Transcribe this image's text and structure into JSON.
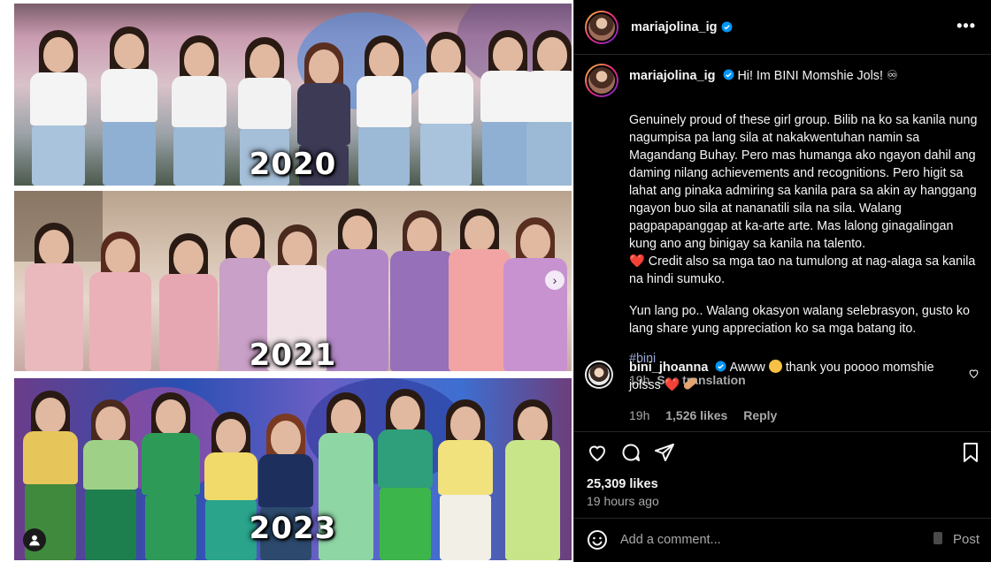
{
  "collage": {
    "panels": [
      {
        "year": "2020"
      },
      {
        "year": "2021"
      },
      {
        "year": "2023"
      }
    ],
    "next_icon": "chevron-right-icon",
    "user_tag_icon": "user-icon"
  },
  "post": {
    "username": "mariajolina_ig",
    "more_icon": "•••",
    "caption": {
      "greeting": "Hi! Im BINI Momshie Jols! ♾",
      "paragraph1": "Genuinely proud of these girl group. Bilib na ko sa kanila nung nagumpisa pa lang sila at nakakwentuhan namin sa Magandang Buhay. Pero mas humanga ako ngayon dahil ang daming nilang achievements and recognitions. Pero higit sa lahat ang pinaka admiring sa kanila para sa akin ay hanggang ngayon buo sila at nananatili sila na sila. Walang pagpapapanggap at ka-arte arte. Mas lalong ginagalingan kung ano ang binigay sa kanila na talento.",
      "heart": "❤️",
      "credit": " Credit also sa mga tao na tumulong at nag-alaga sa kanila na hindi sumuko.",
      "paragraph2": "Yun lang po.. Walang okasyon walang selebrasyon, gusto ko lang share yung appreciation ko sa mga batang ito.",
      "hashtag": "#bini",
      "time": "19h",
      "see_translation": "See translation"
    },
    "comment": {
      "username": "bini_jhoanna",
      "text_before": "Awww",
      "text_after": "thank you poooo momshie jolsss",
      "heart": "❤️",
      "time": "19h",
      "likes": "1,526 likes",
      "reply": "Reply"
    },
    "likes": "25,309 likes",
    "time_ago": "19 hours ago",
    "comment_box": {
      "placeholder": "Add a comment...",
      "post_label": "Post"
    },
    "colors": {
      "background": "#000000",
      "verified": "#0095f6",
      "text_secondary": "#a8a8a8",
      "hashtag": "#9aa8d6",
      "heart": "#ff3040"
    }
  }
}
